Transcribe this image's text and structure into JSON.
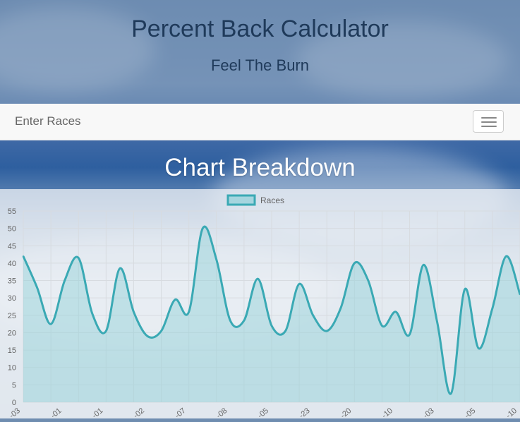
{
  "header": {
    "title": "Percent Back Calculator",
    "subtitle": "Feel The Burn"
  },
  "navbar": {
    "brand": "Enter Races",
    "menu_icon": "hamburger-icon"
  },
  "section": {
    "title": "Chart Breakdown"
  },
  "colors": {
    "line": "#3aa9b4",
    "fill": "#8fd0d8",
    "grid": "#d7dbe0",
    "tick": "#666666"
  },
  "chart_data": {
    "type": "area",
    "legend": {
      "label": "Races",
      "position": "top-center"
    },
    "grid": true,
    "ylim": [
      0,
      55
    ],
    "yticks": [
      0,
      5,
      10,
      15,
      20,
      25,
      30,
      35,
      40,
      45,
      50,
      55
    ],
    "xtick_labels": [
      "-03",
      "-01",
      "-01",
      "-02",
      "-07",
      "-08",
      "-05",
      "-23",
      "-20",
      "-10",
      "-03",
      "-05",
      "-10"
    ],
    "values": [
      42,
      33,
      22.5,
      35,
      41.5,
      25.5,
      20.5,
      38.5,
      26,
      19,
      20.5,
      29.5,
      26,
      50,
      41,
      23.5,
      23.5,
      35.5,
      22,
      20.5,
      34,
      25,
      20.5,
      27,
      40,
      35,
      22,
      26,
      19.5,
      39.5,
      23,
      2.5,
      32.5,
      15.5,
      27,
      42,
      31
    ]
  }
}
